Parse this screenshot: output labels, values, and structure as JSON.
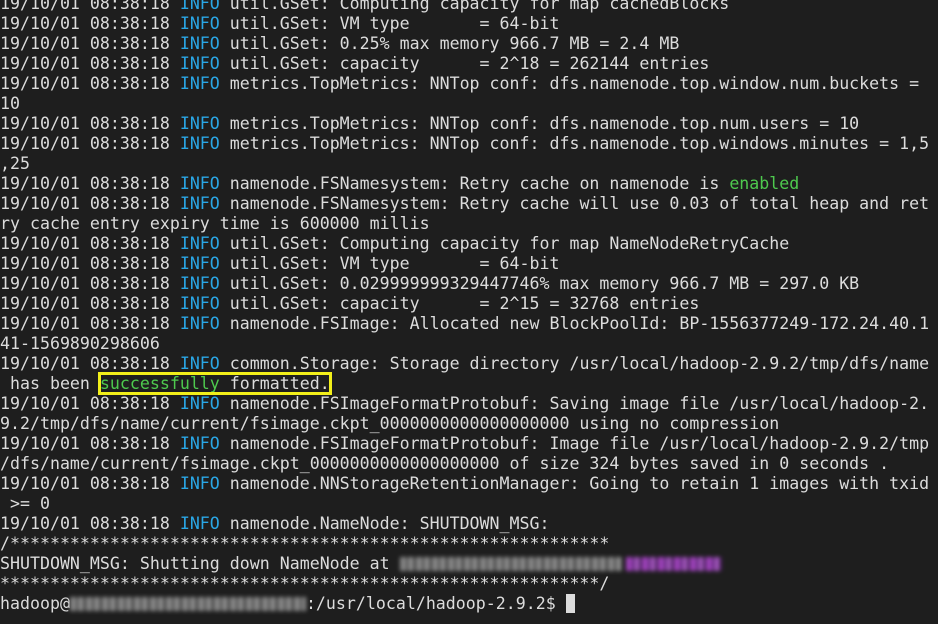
{
  "colors": {
    "background": "#1e1e1e",
    "text": "#dcdcdc",
    "info": "#2aa7e6",
    "enabled": "#4ec94e",
    "highlight_box": "#f2ef1a",
    "redaction_host": "#9a9a9a",
    "redaction_ip": "#b64ad6"
  },
  "terminal": {
    "lines": [
      {
        "pre": "19/10/01 08:38:18 ",
        "info": "INFO",
        "post": " util.GSet: Computing capacity for map cachedBlocks"
      },
      {
        "pre": "19/10/01 08:38:18 ",
        "info": "INFO",
        "post": " util.GSet: VM type       = 64-bit"
      },
      {
        "pre": "19/10/01 08:38:18 ",
        "info": "INFO",
        "post": " util.GSet: 0.25% max memory 966.7 MB = 2.4 MB"
      },
      {
        "pre": "19/10/01 08:38:18 ",
        "info": "INFO",
        "post": " util.GSet: capacity      = 2^18 = 262144 entries"
      },
      {
        "pre": "19/10/01 08:38:18 ",
        "info": "INFO",
        "post": " metrics.TopMetrics: NNTop conf: dfs.namenode.top.window.num.buckets = "
      },
      {
        "pre": "10",
        "info": "",
        "post": ""
      },
      {
        "pre": "19/10/01 08:38:18 ",
        "info": "INFO",
        "post": " metrics.TopMetrics: NNTop conf: dfs.namenode.top.num.users = 10"
      },
      {
        "pre": "19/10/01 08:38:18 ",
        "info": "INFO",
        "post": " metrics.TopMetrics: NNTop conf: dfs.namenode.top.windows.minutes = 1,5"
      },
      {
        "pre": ",25",
        "info": "",
        "post": ""
      },
      {
        "pre": "19/10/01 08:38:18 ",
        "info": "INFO",
        "post": " namenode.FSNamesystem: Retry cache on namenode is ",
        "green": "enabled"
      },
      {
        "pre": "19/10/01 08:38:18 ",
        "info": "INFO",
        "post": " namenode.FSNamesystem: Retry cache will use 0.03 of total heap and ret"
      },
      {
        "pre": "ry cache entry expiry time is 600000 millis",
        "info": "",
        "post": ""
      },
      {
        "pre": "19/10/01 08:38:18 ",
        "info": "INFO",
        "post": " util.GSet: Computing capacity for map NameNodeRetryCache"
      },
      {
        "pre": "19/10/01 08:38:18 ",
        "info": "INFO",
        "post": " util.GSet: VM type       = 64-bit"
      },
      {
        "pre": "19/10/01 08:38:18 ",
        "info": "INFO",
        "post": " util.GSet: 0.029999999329447746% max memory 966.7 MB = 297.0 KB"
      },
      {
        "pre": "19/10/01 08:38:18 ",
        "info": "INFO",
        "post": " util.GSet: capacity      = 2^15 = 32768 entries"
      },
      {
        "pre": "19/10/01 08:38:18 ",
        "info": "INFO",
        "post": " namenode.FSImage: Allocated new BlockPoolId: BP-1556377249-172.24.40.1"
      },
      {
        "pre": "41-1569890298606",
        "info": "",
        "post": ""
      },
      {
        "pre": "19/10/01 08:38:18 ",
        "info": "INFO",
        "post": " common.Storage: Storage directory /usr/local/hadoop-2.9.2/tmp/dfs/name"
      }
    ],
    "formatted_line": {
      "pre": " has been ",
      "green": "successfully",
      "post": " formatted."
    },
    "lines2": [
      {
        "pre": "19/10/01 08:38:18 ",
        "info": "INFO",
        "post": " namenode.FSImageFormatProtobuf: Saving image file /usr/local/hadoop-2."
      },
      {
        "pre": "9.2/tmp/dfs/name/current/fsimage.ckpt_0000000000000000000 using no compression",
        "info": "",
        "post": ""
      },
      {
        "pre": "19/10/01 08:38:18 ",
        "info": "INFO",
        "post": " namenode.FSImageFormatProtobuf: Image file /usr/local/hadoop-2.9.2/tmp"
      },
      {
        "pre": "/dfs/name/current/fsimage.ckpt_0000000000000000000 of size 324 bytes saved in 0 seconds .",
        "info": "",
        "post": ""
      },
      {
        "pre": "19/10/01 08:38:18 ",
        "info": "INFO",
        "post": " namenode.NNStorageRetentionManager: Going to retain 1 images with txid"
      },
      {
        "pre": " >= 0",
        "info": "",
        "post": ""
      },
      {
        "pre": "19/10/01 08:38:18 ",
        "info": "INFO",
        "post": " namenode.NameNode: SHUTDOWN_MSG:"
      },
      {
        "pre": "/************************************************************",
        "info": "",
        "post": ""
      }
    ],
    "shutdown_line": {
      "text": "SHUTDOWN_MSG: Shutting down NameNode at "
    },
    "end_banner": "************************************************************/",
    "prompt": {
      "user": "hadoop@",
      "path": ":/usr/local/hadoop-2.9.2$ "
    }
  }
}
